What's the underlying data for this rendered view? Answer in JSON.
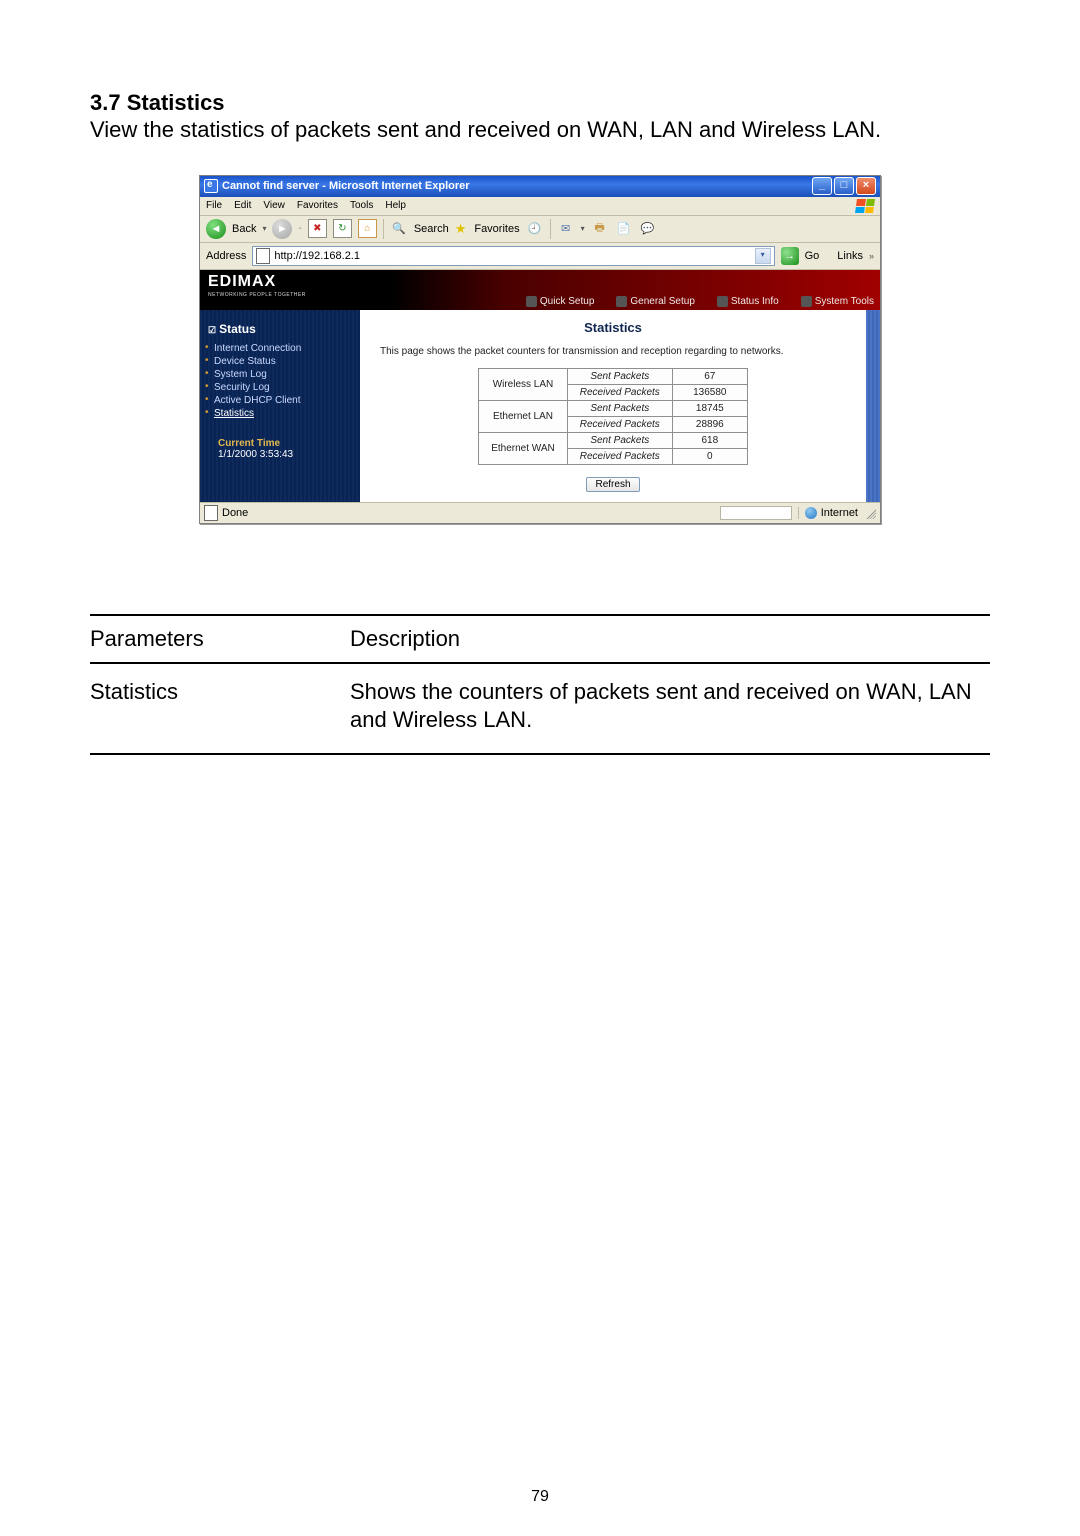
{
  "doc": {
    "section_number": "3.7",
    "section_title": "Statistics",
    "intro": "View the statistics of packets sent and received on WAN, LAN and Wireless LAN.",
    "page_number": "79"
  },
  "param_table": {
    "headers": {
      "col1": "Parameters",
      "col2": "Description"
    },
    "rows": [
      {
        "param": "Statistics",
        "desc": "Shows the counters of packets sent and received on WAN, LAN and Wireless LAN."
      }
    ]
  },
  "ie": {
    "title": "Cannot find server - Microsoft Internet Explorer",
    "menus": [
      "File",
      "Edit",
      "View",
      "Favorites",
      "Tools",
      "Help"
    ],
    "toolbar": {
      "back": "Back",
      "search": "Search",
      "favorites": "Favorites"
    },
    "addressbar": {
      "label": "Address",
      "url": "http://192.168.2.1",
      "go": "Go",
      "links": "Links"
    },
    "status": {
      "done": "Done",
      "zone": "Internet"
    }
  },
  "router": {
    "logo": "EDIMAX",
    "logo_sub": "NETWORKING PEOPLE TOGETHER",
    "tabs": [
      "Quick Setup",
      "General Setup",
      "Status Info",
      "System Tools"
    ],
    "sidebar": {
      "title": "Status",
      "items": [
        {
          "label": "Internet Connection"
        },
        {
          "label": "Device Status"
        },
        {
          "label": "System Log"
        },
        {
          "label": "Security Log"
        },
        {
          "label": "Active DHCP Client"
        },
        {
          "label": "Statistics",
          "active": true
        }
      ],
      "current_time_label": "Current Time",
      "current_time_value": "1/1/2000 3:53:43"
    },
    "panel": {
      "title": "Statistics",
      "desc": "This page shows the packet counters for transmission and reception regarding to networks.",
      "refresh": "Refresh",
      "stats": [
        {
          "iface": "Wireless LAN",
          "sent_label": "Sent Packets",
          "sent": "67",
          "recv_label": "Received Packets",
          "recv": "136580"
        },
        {
          "iface": "Ethernet LAN",
          "sent_label": "Sent Packets",
          "sent": "18745",
          "recv_label": "Received Packets",
          "recv": "28896"
        },
        {
          "iface": "Ethernet WAN",
          "sent_label": "Sent Packets",
          "sent": "618",
          "recv_label": "Received Packets",
          "recv": "0"
        }
      ]
    }
  }
}
